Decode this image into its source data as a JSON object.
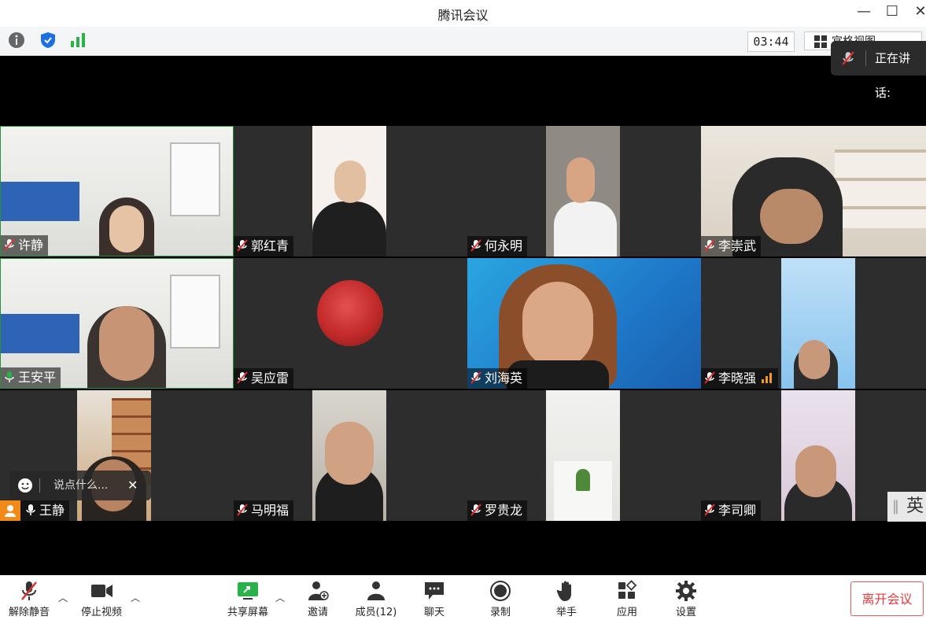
{
  "window": {
    "title": "腾讯会议",
    "minimize": "—",
    "maximize": "☐",
    "close": "✕"
  },
  "toolbar": {
    "timer": "03:44",
    "view_label": "宫格视图"
  },
  "speaking": {
    "label": "正在讲话:"
  },
  "participants": [
    {
      "name": "许静",
      "mic": "muted"
    },
    {
      "name": "郭红青",
      "mic": "muted"
    },
    {
      "name": "何永明",
      "mic": "muted"
    },
    {
      "name": "李崇武",
      "mic": "muted"
    },
    {
      "name": "王安平",
      "mic": "on"
    },
    {
      "name": "吴应雷",
      "mic": "muted"
    },
    {
      "name": "刘海英",
      "mic": "muted"
    },
    {
      "name": "李晓强",
      "mic": "muted"
    },
    {
      "name": "王静",
      "mic": "on"
    },
    {
      "name": "马明福",
      "mic": "muted"
    },
    {
      "name": "罗贵龙",
      "mic": "muted"
    },
    {
      "name": "李司卿",
      "mic": "muted"
    }
  ],
  "chat": {
    "placeholder": "说点什么..."
  },
  "ime": {
    "label": "英"
  },
  "bottombar": {
    "unmute": "解除静音",
    "stop_video": "停止视频",
    "share": "共享屏幕",
    "invite": "邀请",
    "members": "成员(12)",
    "chat": "聊天",
    "record": "录制",
    "raise_hand": "举手",
    "apps": "应用",
    "settings": "设置",
    "leave": "离开会议"
  },
  "colors": {
    "accent_green": "#2a8f3a",
    "leave_red": "#e23c3c",
    "stage_bg": "#000000",
    "tile_bg": "#2d2d2d"
  }
}
